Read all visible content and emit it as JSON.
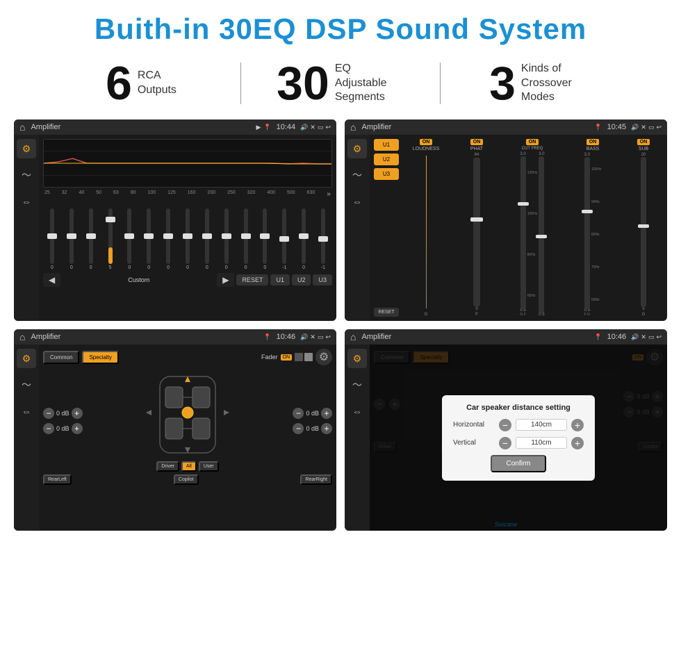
{
  "header": {
    "title": "Buith-in 30EQ DSP Sound System"
  },
  "stats": [
    {
      "number": "6",
      "label": "RCA\nOutputs"
    },
    {
      "number": "30",
      "label": "EQ Adjustable\nSegments"
    },
    {
      "number": "3",
      "label": "Kinds of\nCrossover Modes"
    }
  ],
  "screen1": {
    "app": "Amplifier",
    "time": "10:44",
    "eq_freqs": [
      "25",
      "32",
      "40",
      "50",
      "63",
      "80",
      "100",
      "125",
      "160",
      "200",
      "250",
      "320",
      "400",
      "500",
      "630"
    ],
    "eq_values": [
      "0",
      "0",
      "0",
      "5",
      "0",
      "0",
      "0",
      "0",
      "0",
      "0",
      "0",
      "0",
      "-1",
      "0",
      "-1"
    ],
    "buttons": [
      "◀",
      "Custom",
      "▶",
      "RESET",
      "U1",
      "U2",
      "U3"
    ]
  },
  "screen2": {
    "app": "Amplifier",
    "time": "10:45",
    "presets": [
      "U1",
      "U2",
      "U3"
    ],
    "controls": [
      "LOUDNESS",
      "PHAT",
      "CUT FREQ",
      "BASS",
      "SUB"
    ],
    "reset": "RESET"
  },
  "screen3": {
    "app": "Amplifier",
    "time": "10:46",
    "tabs": [
      "Common",
      "Specialty"
    ],
    "fader": "Fader",
    "on": "ON",
    "positions": [
      "Driver",
      "RearLeft",
      "All",
      "User",
      "RearRight",
      "Copilot"
    ],
    "db_rows": [
      {
        "left": "0 dB",
        "right": "0 dB"
      },
      {
        "left": "0 dB",
        "right": "0 dB"
      }
    ]
  },
  "screen4": {
    "app": "Amplifier",
    "time": "10:46",
    "tabs": [
      "Common",
      "Specialty"
    ],
    "on": "ON",
    "dialog": {
      "title": "Car speaker distance setting",
      "horizontal_label": "Horizontal",
      "horizontal_val": "140cm",
      "vertical_label": "Vertical",
      "vertical_val": "110cm",
      "confirm": "Confirm"
    },
    "positions": [
      "Driver",
      "RearLeft",
      "User",
      "RearRight",
      "Copilot"
    ],
    "db_rows": [
      {
        "right": "0 dB"
      },
      {
        "right": "0 dB"
      }
    ]
  },
  "watermark": "Seicane"
}
